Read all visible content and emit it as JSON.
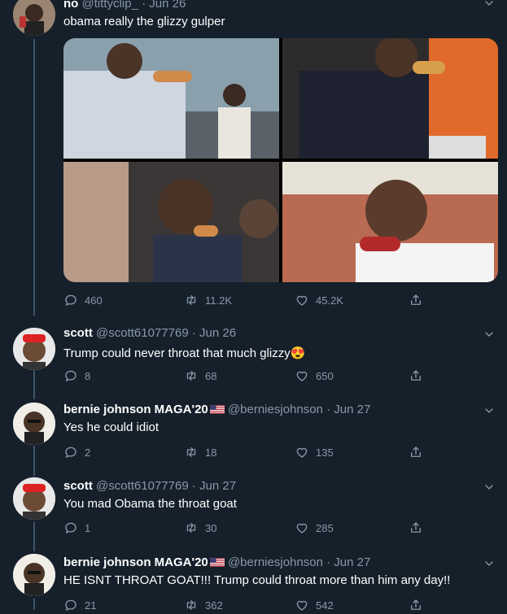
{
  "tweets": [
    {
      "name": "no",
      "handle": "@tittyclip_",
      "date": "Jun 26",
      "text": "obama really the glizzy gulper",
      "replies": "460",
      "retweets": "11.2K",
      "likes": "45.2K"
    },
    {
      "name": "scott",
      "handle": "@scott61077769",
      "date": "Jun 26",
      "text": "Trump could never throat that much glizzy",
      "emoji": "😍",
      "replies": "8",
      "retweets": "68",
      "likes": "650"
    },
    {
      "name": "bernie johnson MAGA'20",
      "handle": "@berniesjohnson",
      "date": "Jun 27",
      "text": "Yes he could idiot",
      "replies": "2",
      "retweets": "18",
      "likes": "135"
    },
    {
      "name": "scott",
      "handle": "@scott61077769",
      "date": "Jun 27",
      "text": "You mad Obama the throat goat",
      "replies": "1",
      "retweets": "30",
      "likes": "285"
    },
    {
      "name": "bernie johnson MAGA'20",
      "handle": "@berniesjohnson",
      "date": "Jun 27",
      "text": "HE ISNT THROAT GOAT!!! Trump could throat more than him any day!!",
      "replies": "21",
      "retweets": "362",
      "likes": "542"
    }
  ],
  "separator": "·",
  "colors": {
    "background": "#15202b",
    "secondary_text": "#8899a6",
    "thread_line": "#3d5466"
  },
  "icons": {
    "reply": "reply-icon",
    "retweet": "retweet-icon",
    "like": "heart-icon",
    "share": "share-icon",
    "more": "chevron-down-icon"
  }
}
